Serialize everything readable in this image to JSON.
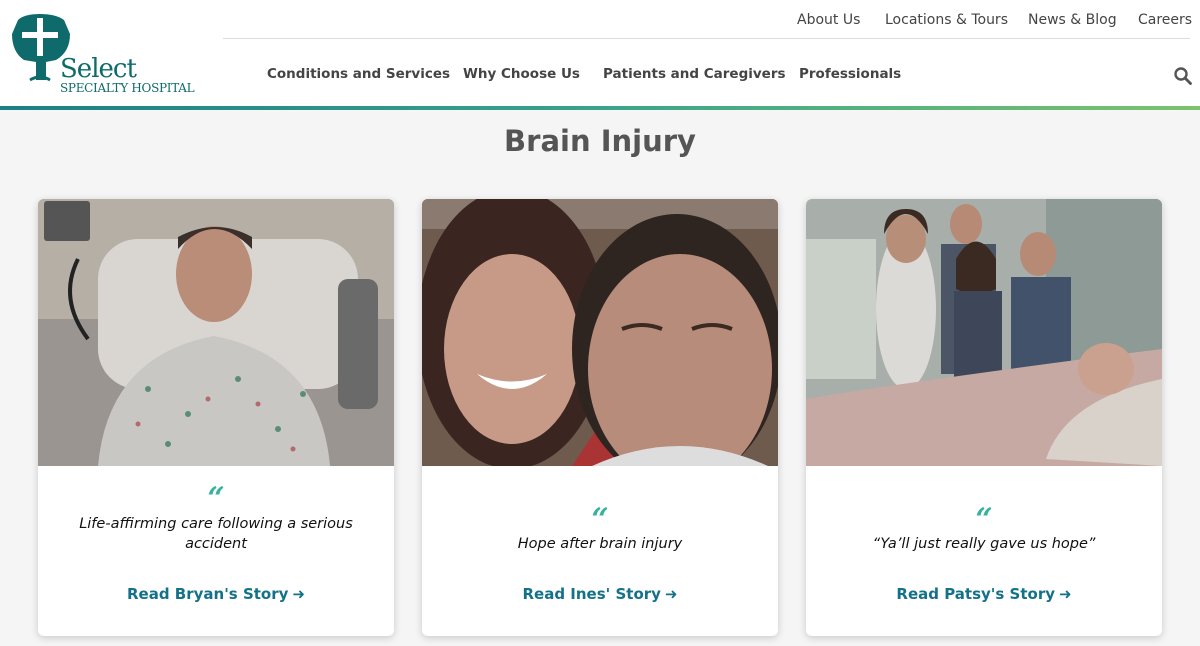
{
  "brand": {
    "name": "Select",
    "subname": "SPECIALTY HOSPITAL",
    "color": "#0f6b6b"
  },
  "top_nav": [
    {
      "label": "About Us"
    },
    {
      "label": "Locations & Tours"
    },
    {
      "label": "News & Blog"
    },
    {
      "label": "Careers"
    }
  ],
  "main_nav": [
    {
      "label": "Conditions and Services"
    },
    {
      "label": "Why Choose Us"
    },
    {
      "label": "Patients and Caregivers"
    },
    {
      "label": "Professionals"
    }
  ],
  "search": {
    "icon": "search-icon"
  },
  "page": {
    "title": "Brain Injury"
  },
  "accent_colors": {
    "link": "#13718a",
    "quote": "#38b2a0",
    "gradient_start": "#1c7f86",
    "gradient_end": "#7cc26e"
  },
  "cards": [
    {
      "quote_mark": "“",
      "quote": "Life-affirming care following a serious accident",
      "link_label": "Read Bryan's Story",
      "link_icon": "arrow-right-icon"
    },
    {
      "quote_mark": "“",
      "quote": "Hope after brain injury",
      "link_label": "Read Ines' Story",
      "link_icon": "arrow-right-icon"
    },
    {
      "quote_mark": "“",
      "quote": "“Ya’ll just really gave us hope”",
      "link_label": "Read Patsy's Story",
      "link_icon": "arrow-right-icon"
    }
  ]
}
